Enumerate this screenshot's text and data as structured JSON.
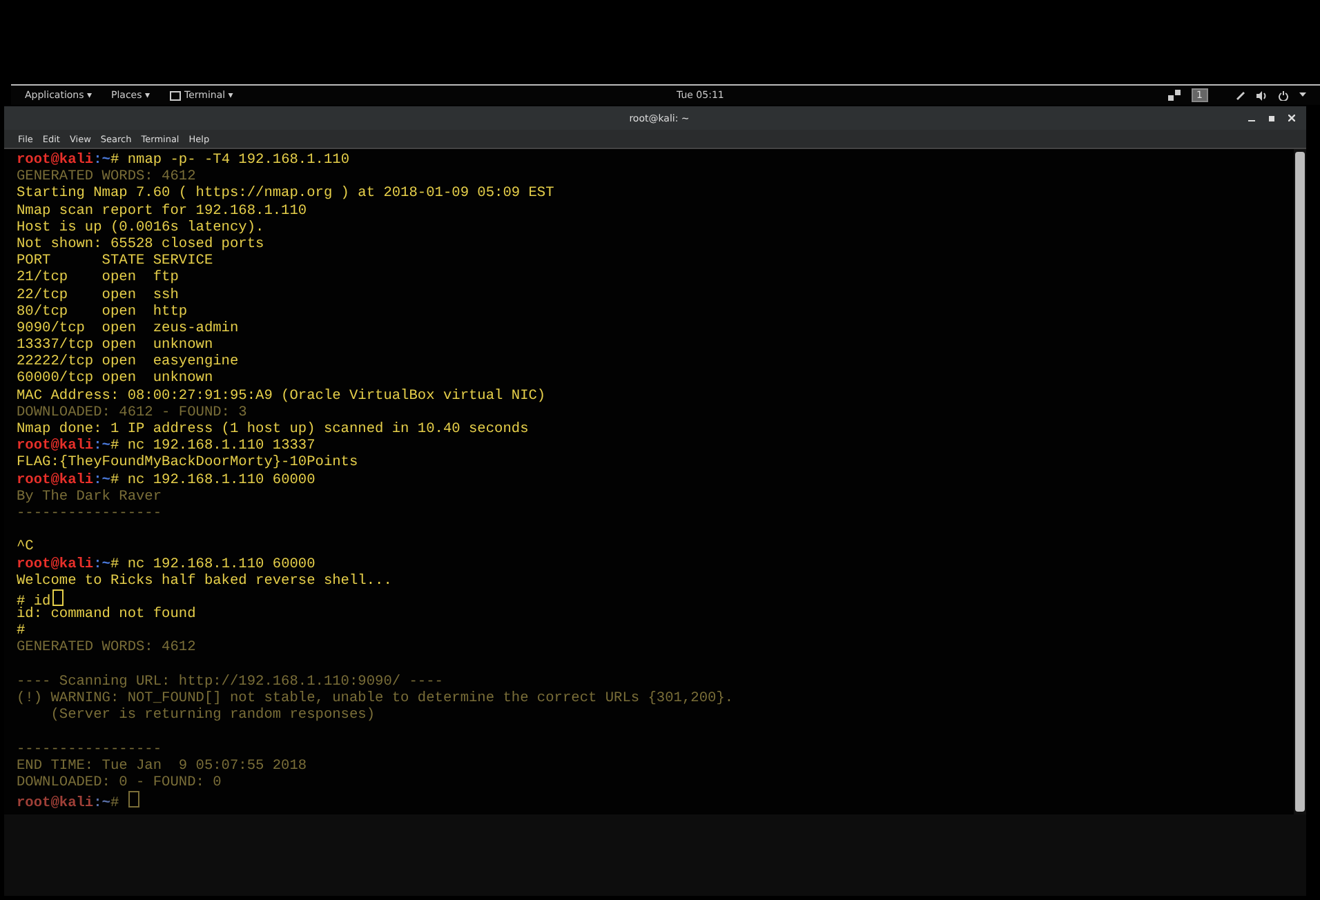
{
  "top_panel": {
    "menus": [
      {
        "label": "Applications ▾",
        "icon": false
      },
      {
        "label": "Places ▾",
        "icon": false
      },
      {
        "label": "Terminal ▾",
        "icon": true
      }
    ],
    "clock": "Tue 05:11",
    "workspace": "1"
  },
  "window": {
    "title": "root@kali: ~"
  },
  "menu_bar": [
    "File",
    "Edit",
    "View",
    "Search",
    "Terminal",
    "Help"
  ],
  "terminal": {
    "lines": [
      {
        "kind": "prompt",
        "user": "root@kali",
        "path": ":~",
        "text": "# nmap -p- -T4 192.168.1.110"
      },
      {
        "kind": "faded",
        "text": "GENERATED WORDS: 4612"
      },
      {
        "kind": "output",
        "text": "Starting Nmap 7.60 ( https://nmap.org ) at 2018-01-09 05:09 EST"
      },
      {
        "kind": "output",
        "text": "Nmap scan report for 192.168.1.110"
      },
      {
        "kind": "output",
        "text": "Host is up (0.0016s latency)."
      },
      {
        "kind": "output",
        "text": "Not shown: 65528 closed ports"
      },
      {
        "kind": "output",
        "text": "PORT      STATE SERVICE"
      },
      {
        "kind": "output",
        "text": "21/tcp    open  ftp"
      },
      {
        "kind": "output",
        "text": "22/tcp    open  ssh"
      },
      {
        "kind": "output",
        "text": "80/tcp    open  http"
      },
      {
        "kind": "output",
        "text": "9090/tcp  open  zeus-admin"
      },
      {
        "kind": "output",
        "text": "13337/tcp open  unknown"
      },
      {
        "kind": "output",
        "text": "22222/tcp open  easyengine"
      },
      {
        "kind": "output",
        "text": "60000/tcp open  unknown"
      },
      {
        "kind": "output",
        "text": "MAC Address: 08:00:27:91:95:A9 (Oracle VirtualBox virtual NIC)"
      },
      {
        "kind": "faded",
        "text": "DOWNLOADED: 4612 - FOUND: 3"
      },
      {
        "kind": "output",
        "text": "Nmap done: 1 IP address (1 host up) scanned in 10.40 seconds"
      },
      {
        "kind": "prompt",
        "user": "root@kali",
        "path": ":~",
        "text": "# nc 192.168.1.110 13337"
      },
      {
        "kind": "output",
        "text": "FLAG:{TheyFoundMyBackDoorMorty}-10Points"
      },
      {
        "kind": "prompt",
        "user": "root@kali",
        "path": ":~",
        "text": "# nc 192.168.1.110 60000"
      },
      {
        "kind": "faded",
        "text": "By The Dark Raver"
      },
      {
        "kind": "faded",
        "text": "-----------------"
      },
      {
        "kind": "blank"
      },
      {
        "kind": "output",
        "text": "^C"
      },
      {
        "kind": "prompt",
        "user": "root@kali",
        "path": ":~",
        "text": "# nc 192.168.1.110 60000"
      },
      {
        "kind": "output",
        "text": "Welcome to Ricks half baked reverse shell..."
      },
      {
        "kind": "output",
        "text": "# id",
        "cursor": true
      },
      {
        "kind": "output",
        "text": "id: command not found"
      },
      {
        "kind": "output",
        "text": "#"
      },
      {
        "kind": "faded",
        "text": "GENERATED WORDS: 4612"
      },
      {
        "kind": "blank"
      },
      {
        "kind": "faded",
        "text": "---- Scanning URL: http://192.168.1.110:9090/ ----"
      },
      {
        "kind": "faded",
        "text": "(!) WARNING: NOT_FOUND[] not stable, unable to determine the correct URLs {301,200}."
      },
      {
        "kind": "faded",
        "text": "    (Server is returning random responses)"
      },
      {
        "kind": "blank"
      },
      {
        "kind": "faded",
        "text": "-----------------"
      },
      {
        "kind": "faded",
        "text": "END TIME: Tue Jan  9 05:07:55 2018"
      },
      {
        "kind": "faded",
        "text": "DOWNLOADED: 0 - FOUND: 0"
      },
      {
        "kind": "faded_prompt",
        "user": "root@kali",
        "path": ":~",
        "text": "# ",
        "cursor": true
      }
    ]
  }
}
